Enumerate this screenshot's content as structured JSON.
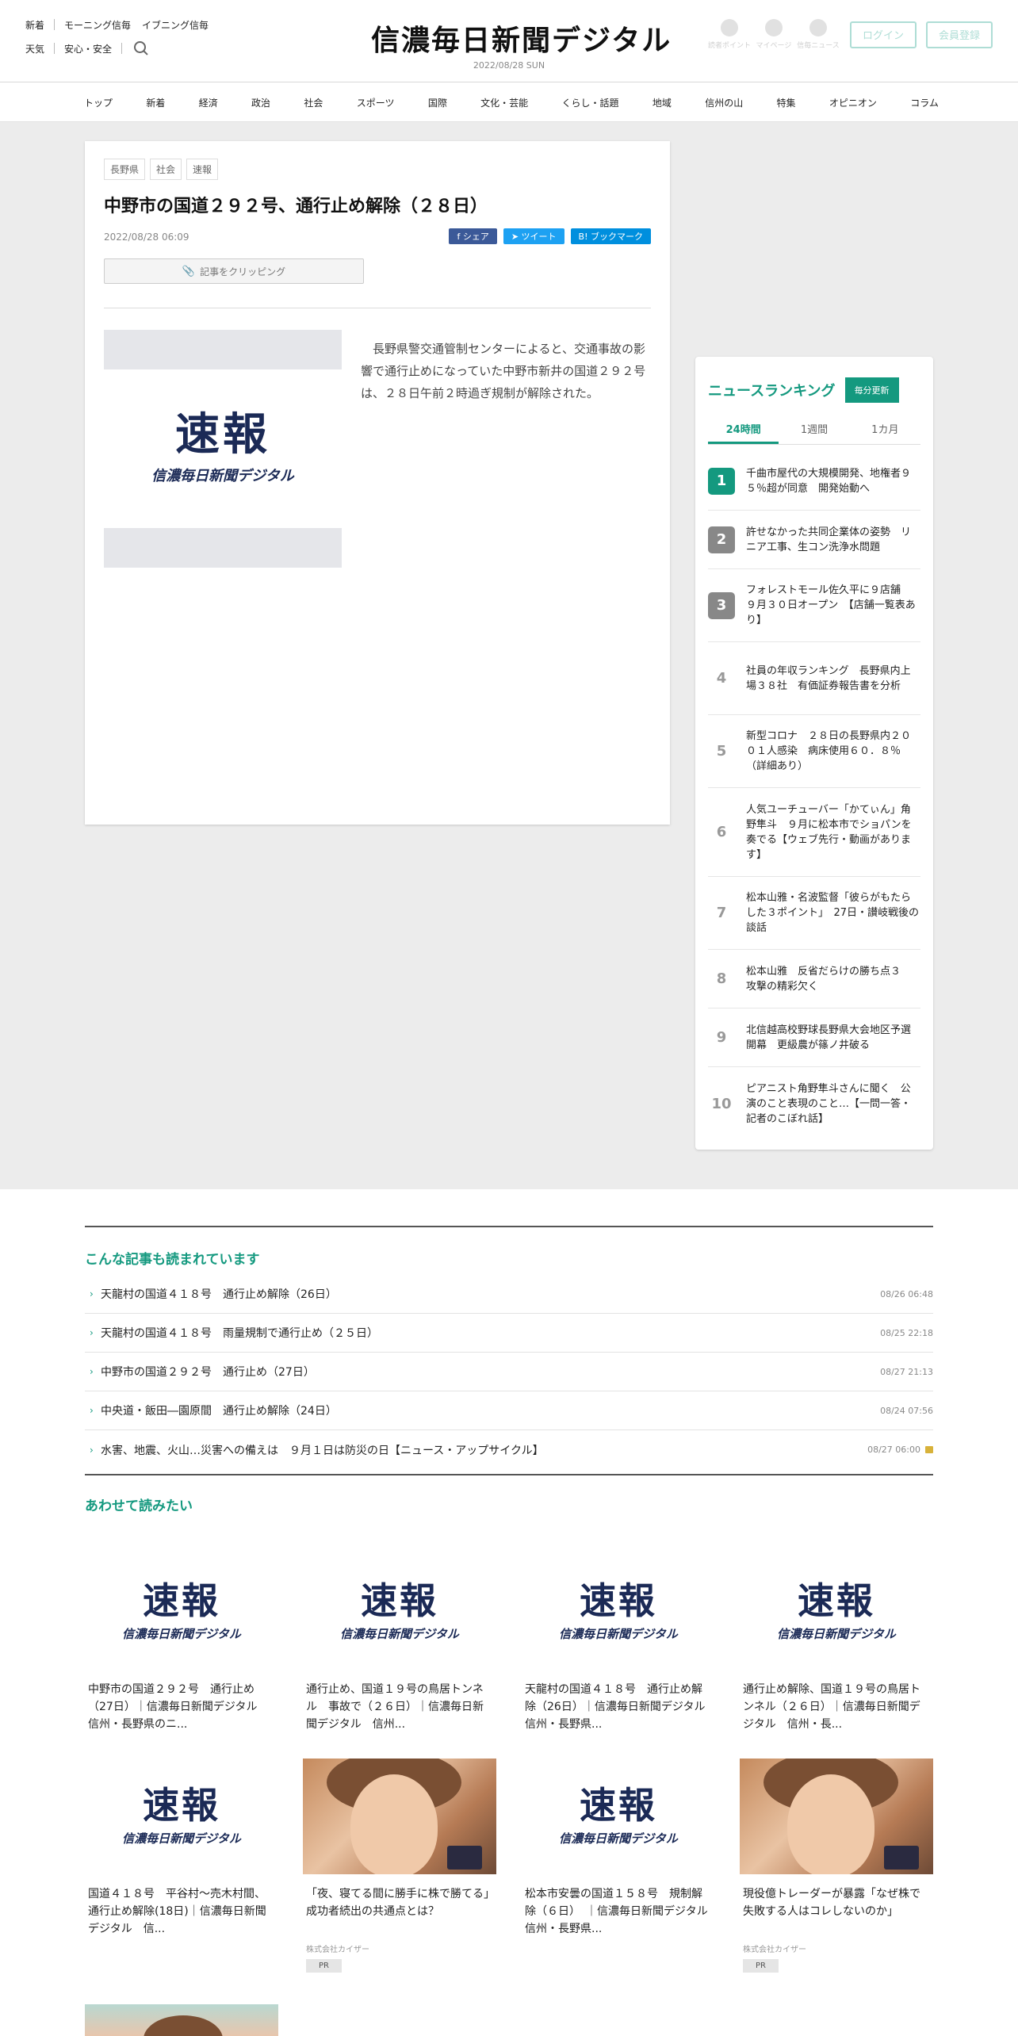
{
  "header": {
    "left_row1": [
      "新着",
      "モーニング信毎",
      "イブニング信毎"
    ],
    "left_row2": [
      "天気",
      "安心・安全"
    ],
    "logo": "信濃毎日新聞デジタル",
    "date": "2022/08/28 SUN",
    "icons": [
      {
        "label": "読者ポイント"
      },
      {
        "label": "マイページ"
      },
      {
        "label": "信毎ニュース"
      }
    ],
    "login": "ログイン",
    "register": "会員登録"
  },
  "nav": [
    "トップ",
    "新着",
    "経済",
    "政治",
    "社会",
    "スポーツ",
    "国際",
    "文化・芸能",
    "くらし・話題",
    "地域",
    "信州の山",
    "特集",
    "オピニオン",
    "コラム"
  ],
  "article": {
    "tags": [
      "長野県",
      "社会",
      "速報"
    ],
    "title": "中野市の国道２９２号、通行止め解除（２８日）",
    "date": "2022/08/28 06:09",
    "share_fb": "シェア",
    "share_tw": "ツイート",
    "share_hb": "ブックマーク",
    "clip": "記事をクリッピング",
    "image_big": "速報",
    "image_small": "信濃毎日新聞デジタル",
    "body": "長野県警交通管制センターによると、交通事故の影響で通行止めになっていた中野市新井の国道２９２号は、２８日午前２時過ぎ規制が解除された。"
  },
  "ranking": {
    "title": "ニュースランキング",
    "badge": "毎分更新",
    "tabs": [
      "24時間",
      "1週間",
      "1カ月"
    ],
    "items": [
      {
        "rank": "1",
        "text": "千曲市屋代の大規模開発、地権者９５％超が同意　開発始動へ"
      },
      {
        "rank": "2",
        "text": "許せなかった共同企業体の姿勢　リニア工事、生コン洗浄水問題"
      },
      {
        "rank": "3",
        "text": "フォレストモール佐久平に９店舗　９月３０日オープン　【店舗一覧表あり】"
      },
      {
        "rank": "4",
        "text": "社員の年収ランキング　長野県内上場３８社　有価証券報告書を分析"
      },
      {
        "rank": "5",
        "text": "新型コロナ　２８日の長野県内２００１人感染　病床使用６０．８％（詳細あり）"
      },
      {
        "rank": "6",
        "text": "人気ユーチューバー「かてぃん」角野隼斗　９月に松本市でショパンを奏でる【ウェブ先行・動画があります】"
      },
      {
        "rank": "7",
        "text": "松本山雅・名波監督「彼らがもたらした３ポイント」　27日・讃岐戦後の談話"
      },
      {
        "rank": "8",
        "text": "松本山雅　反省だらけの勝ち点３　攻撃の精彩欠く"
      },
      {
        "rank": "9",
        "text": "北信越高校野球長野県大会地区予選開幕　更級農が篠ノ井破る"
      },
      {
        "rank": "10",
        "text": "ピアニスト角野隼斗さんに聞く　公演のこと表現のこと…【一問一答・記者のこぼれ話】"
      }
    ]
  },
  "related": {
    "title": "こんな記事も読まれています",
    "items": [
      {
        "title": "天龍村の国道４１８号　通行止め解除（26日）",
        "date": "08/26 06:48"
      },
      {
        "title": "天龍村の国道４１８号　雨量規制で通行止め（２５日）",
        "date": "08/25 22:18"
      },
      {
        "title": "中野市の国道２９２号　通行止め（27日）",
        "date": "08/27 21:13"
      },
      {
        "title": "中央道・飯田―園原間　通行止め解除（24日）",
        "date": "08/24 07:56"
      },
      {
        "title": "水害、地震、火山…災害への備えは　９月１日は防災の日【ニュース・アップサイクル】",
        "date": "08/27 06:00"
      }
    ]
  },
  "recommend": {
    "title": "あわせて読みたい",
    "thumb_big": "速報",
    "thumb_small": "信濃毎日新聞デジタル",
    "cards": [
      {
        "title": "中野市の国道２９２号　通行止め（27日）｜信濃毎日新聞デジタル　信州・長野県のニ...",
        "photo": false
      },
      {
        "title": "通行止め、国道１９号の鳥居トンネル　事故で（２６日）｜信濃毎日新聞デジタル　信州...",
        "photo": false
      },
      {
        "title": "天龍村の国道４１８号　通行止め解除（26日）｜信濃毎日新聞デジタル　信州・長野県...",
        "photo": false
      },
      {
        "title": "通行止め解除、国道１９号の鳥居トンネル（２６日）｜信濃毎日新聞デジタル　信州・長...",
        "photo": false
      },
      {
        "title": "国道４１８号　平谷村～売木村間、通行止め解除(18日)｜信濃毎日新聞デジタル　信...",
        "photo": false
      },
      {
        "title": "「夜、寝てる間に勝手に株で勝てる」成功者続出の共通点とは？",
        "photo": true,
        "sponsor": "株式会社カイザー",
        "pr": "PR"
      },
      {
        "title": "松本市安曇の国道１５８号　規制解除（６日）　｜信濃毎日新聞デジタル　信州・長野県...",
        "photo": false
      },
      {
        "title": "現役億トレーダーが暴露「なぜ株で失敗する人はコレしないのか」",
        "photo": true,
        "sponsor": "株式会社カイザー",
        "pr": "PR"
      }
    ]
  }
}
